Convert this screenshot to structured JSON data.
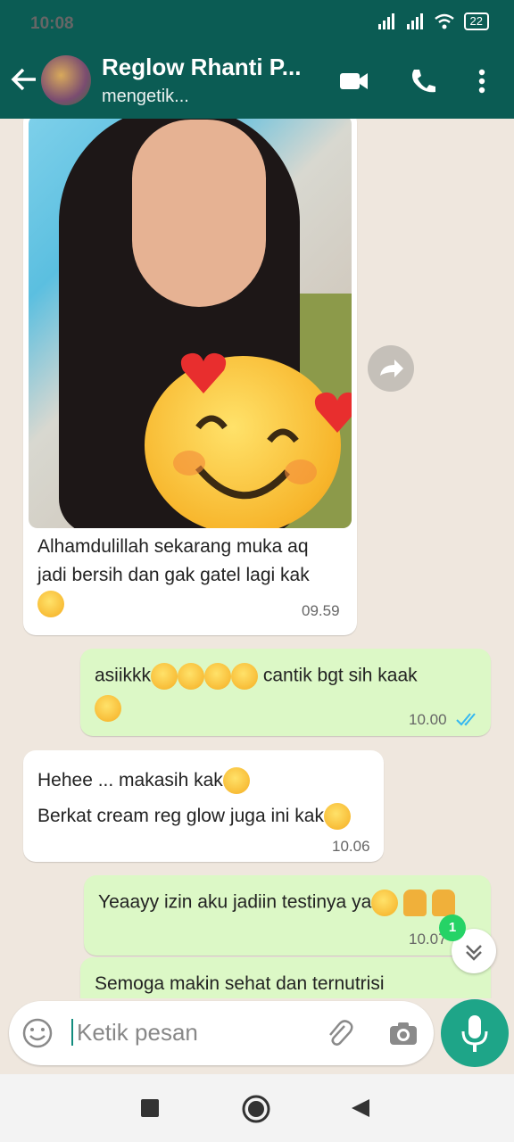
{
  "status": {
    "time": "10:08",
    "battery": "22"
  },
  "header": {
    "name": "Reglow Rhanti P...",
    "subtitle": "mengetik..."
  },
  "messages": [
    {
      "text_line1": "Alhamdulillah sekarang muka aq",
      "text_line2": "jadi bersih dan gak gatel lagi kak",
      "time": "09.59"
    },
    {
      "text": "asiikkk",
      "text2": "cantik bgt sih kaak",
      "time": "10.00"
    },
    {
      "line1": "Hehee ... makasih kak",
      "line2": "Berkat cream reg glow juga ini kak",
      "time": "10.06"
    },
    {
      "text": "Yeaayy izin aku jadiin testinya ya",
      "time": "10.07"
    },
    {
      "text": "Semoga makin sehat dan ternutrisi"
    }
  ],
  "unread_count": "1",
  "input": {
    "placeholder": "Ketik pesan"
  },
  "icons": [
    "back-arrow-icon",
    "video-call-icon",
    "phone-icon",
    "more-icon",
    "forward-icon",
    "emoji-icon",
    "attach-icon",
    "camera-icon",
    "mic-icon",
    "chevron-down-icon"
  ],
  "colors": {
    "header": "#0b5c54",
    "outgoing": "#dcf8c6",
    "accent": "#1ea588"
  }
}
